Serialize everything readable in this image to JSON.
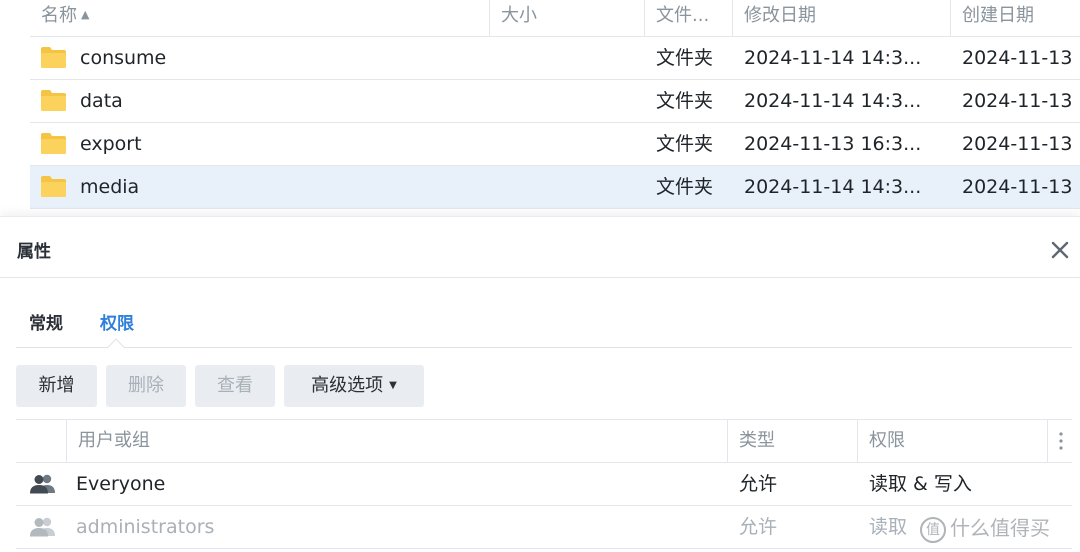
{
  "file_list": {
    "columns": [
      {
        "label": "名称",
        "sort": "asc"
      },
      {
        "label": "大小"
      },
      {
        "label": "文件..."
      },
      {
        "label": "修改日期"
      },
      {
        "label": "创建日期"
      }
    ],
    "rows": [
      {
        "name": "consume",
        "size": "",
        "type": "文件夹",
        "modified": "2024-11-14 14:3...",
        "created": "2024-11-13",
        "selected": false
      },
      {
        "name": "data",
        "size": "",
        "type": "文件夹",
        "modified": "2024-11-14 14:3...",
        "created": "2024-11-13",
        "selected": false
      },
      {
        "name": "export",
        "size": "",
        "type": "文件夹",
        "modified": "2024-11-13 16:3...",
        "created": "2024-11-13",
        "selected": false
      },
      {
        "name": "media",
        "size": "",
        "type": "文件夹",
        "modified": "2024-11-14 14:3...",
        "created": "2024-11-13",
        "selected": true
      }
    ],
    "sort_arrow_icon": "caret-up-icon",
    "folder_icon": "folder-icon",
    "folder_color": "#f5c445"
  },
  "dialog": {
    "title": "属性",
    "close_icon": "close-icon",
    "tabs": [
      {
        "label": "常规",
        "active": false
      },
      {
        "label": "权限",
        "active": true
      }
    ],
    "toolbar": {
      "add_label": "新增",
      "delete_label": "删除",
      "view_label": "查看",
      "advanced_label": "高级选项",
      "advanced_caret_icon": "caret-down-icon"
    },
    "permissions": {
      "columns": [
        {
          "label": "用户或组"
        },
        {
          "label": "类型"
        },
        {
          "label": "权限"
        }
      ],
      "menu_icon": "vertical-ellipsis-icon",
      "rows": [
        {
          "user": "Everyone",
          "type": "允许",
          "permission": "读取 & 写入",
          "icon": "group-icon",
          "dimmed": false
        },
        {
          "user": "administrators",
          "type": "允许",
          "permission": "读取",
          "icon": "group-icon",
          "dimmed": true
        }
      ]
    }
  },
  "watermark": {
    "logo": "值",
    "text": "什么值得买"
  },
  "colors": {
    "accent": "#2f7fdc",
    "selected_row": "#e8f0fa",
    "button_bg": "#e9edf1",
    "muted_text": "#8a949d",
    "disabled_text": "#a8b0b8"
  }
}
